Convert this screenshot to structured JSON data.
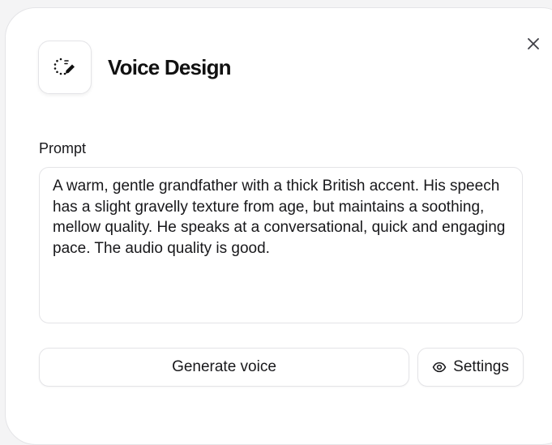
{
  "dialog": {
    "title": "Voice Design",
    "close_icon": "close-icon",
    "logo_icon": "voice-design-icon"
  },
  "prompt": {
    "label": "Prompt",
    "value": "A warm, gentle grandfather with a thick British accent. His speech has a slight gravelly texture from age, but maintains a soothing, mellow quality. He speaks at a conversational, quick and engaging pace. The audio quality is good."
  },
  "actions": {
    "generate_label": "Generate voice",
    "settings_label": "Settings",
    "settings_icon": "eye-icon"
  },
  "colors": {
    "text": "#18181b",
    "border": "#e4e4e7",
    "background": "#ffffff"
  }
}
